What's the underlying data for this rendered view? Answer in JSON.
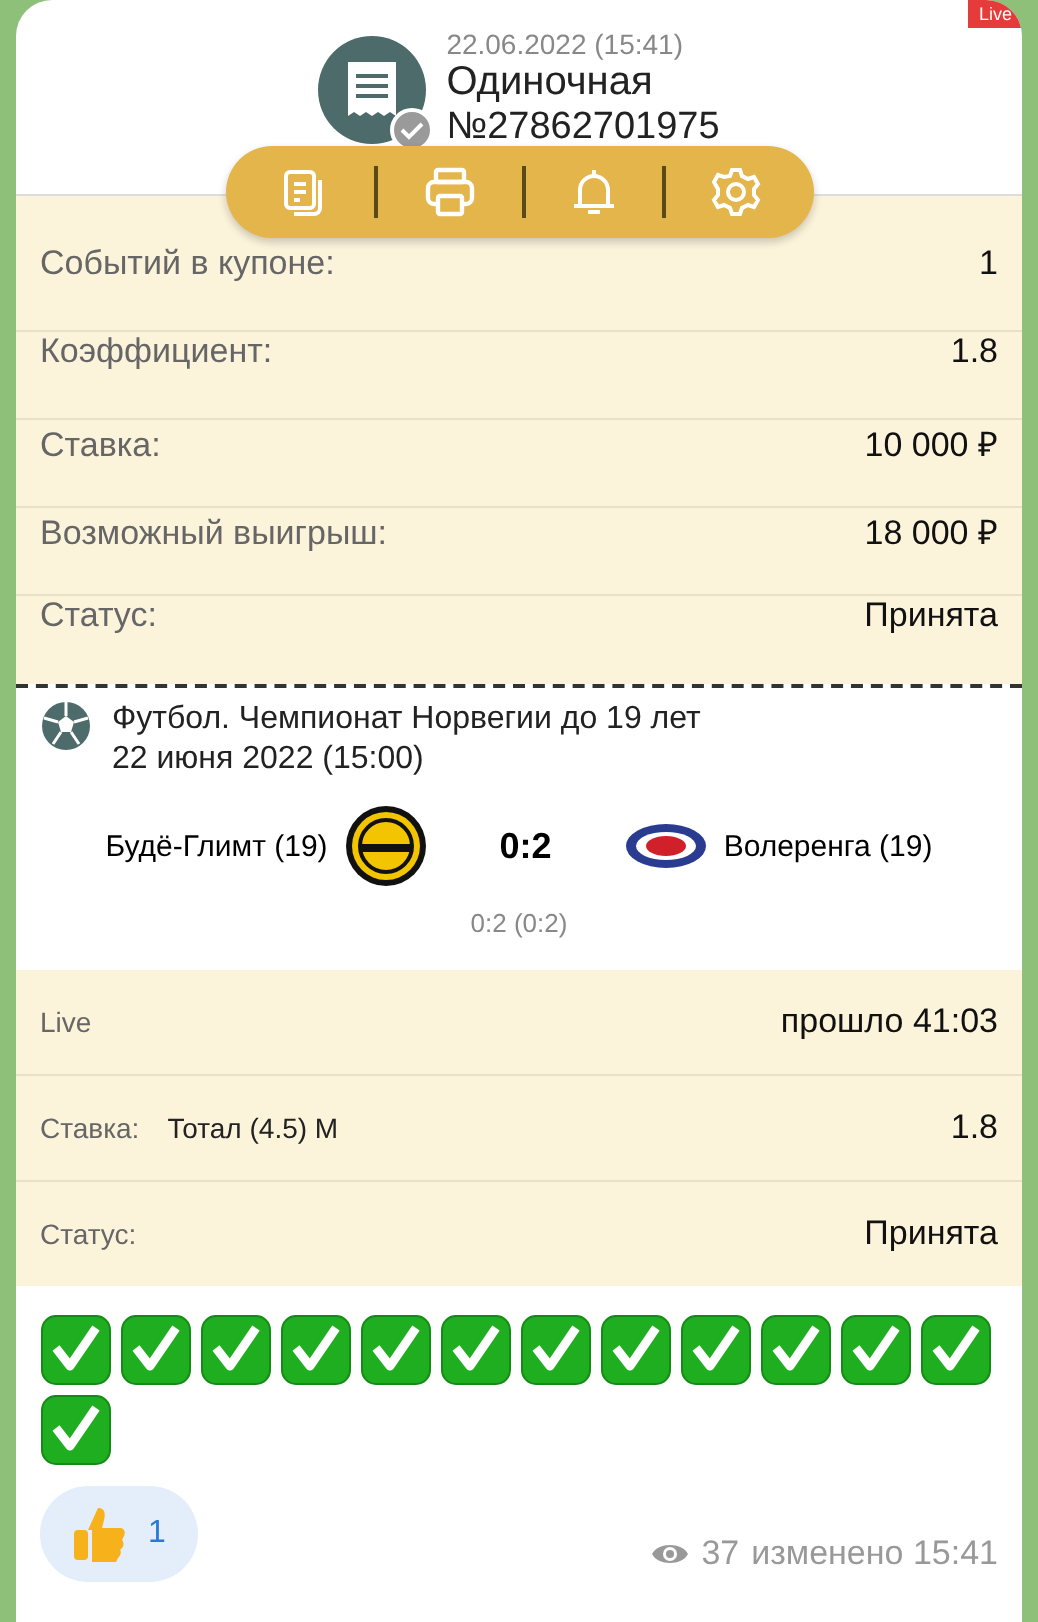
{
  "badge": {
    "label": "Live"
  },
  "header": {
    "datetime": "22.06.2022 (15:41)",
    "title": "Одиночная",
    "number": "№27862701975",
    "confirmed": true
  },
  "toolbar": [
    {
      "kind": "copy"
    },
    {
      "kind": "print"
    },
    {
      "kind": "bell"
    },
    {
      "kind": "settings"
    }
  ],
  "summary": [
    {
      "label": "Событий в купоне:",
      "value": "1"
    },
    {
      "label": "Коэффициент:",
      "value": "1.8"
    },
    {
      "label": "Ставка:",
      "value": "10 000 ₽"
    },
    {
      "label": "Возможный выигрыш:",
      "value": "18 000 ₽"
    },
    {
      "label": "Статус:",
      "value": "Принята"
    }
  ],
  "event": {
    "league": "Футбол. Чемпионат Норвегии до 19 лет",
    "date": "22 июня 2022 (15:00)",
    "home": "Будё-Глимт (19)",
    "score": "0:2",
    "away": "Волеренга (19)",
    "details": "0:2 (0:2)"
  },
  "bet": {
    "live_label": "Live",
    "elapsed": "прошло 41:03",
    "stake_label": "Ставка:",
    "stake_market": "Тотал (4.5) М",
    "stake_odds": "1.8",
    "status_label": "Статус:",
    "status": "Принята"
  },
  "message": {
    "emojis": [
      {
        "kind": "check"
      },
      {
        "kind": "check"
      },
      {
        "kind": "check"
      },
      {
        "kind": "check"
      },
      {
        "kind": "check"
      },
      {
        "kind": "check"
      },
      {
        "kind": "check"
      },
      {
        "kind": "check"
      },
      {
        "kind": "check"
      },
      {
        "kind": "check"
      },
      {
        "kind": "check"
      },
      {
        "kind": "check"
      },
      {
        "kind": "check"
      }
    ],
    "reaction": {
      "kind": "thumbs-up",
      "count": "1"
    },
    "views": "37",
    "edited": "изменено 15:41"
  }
}
